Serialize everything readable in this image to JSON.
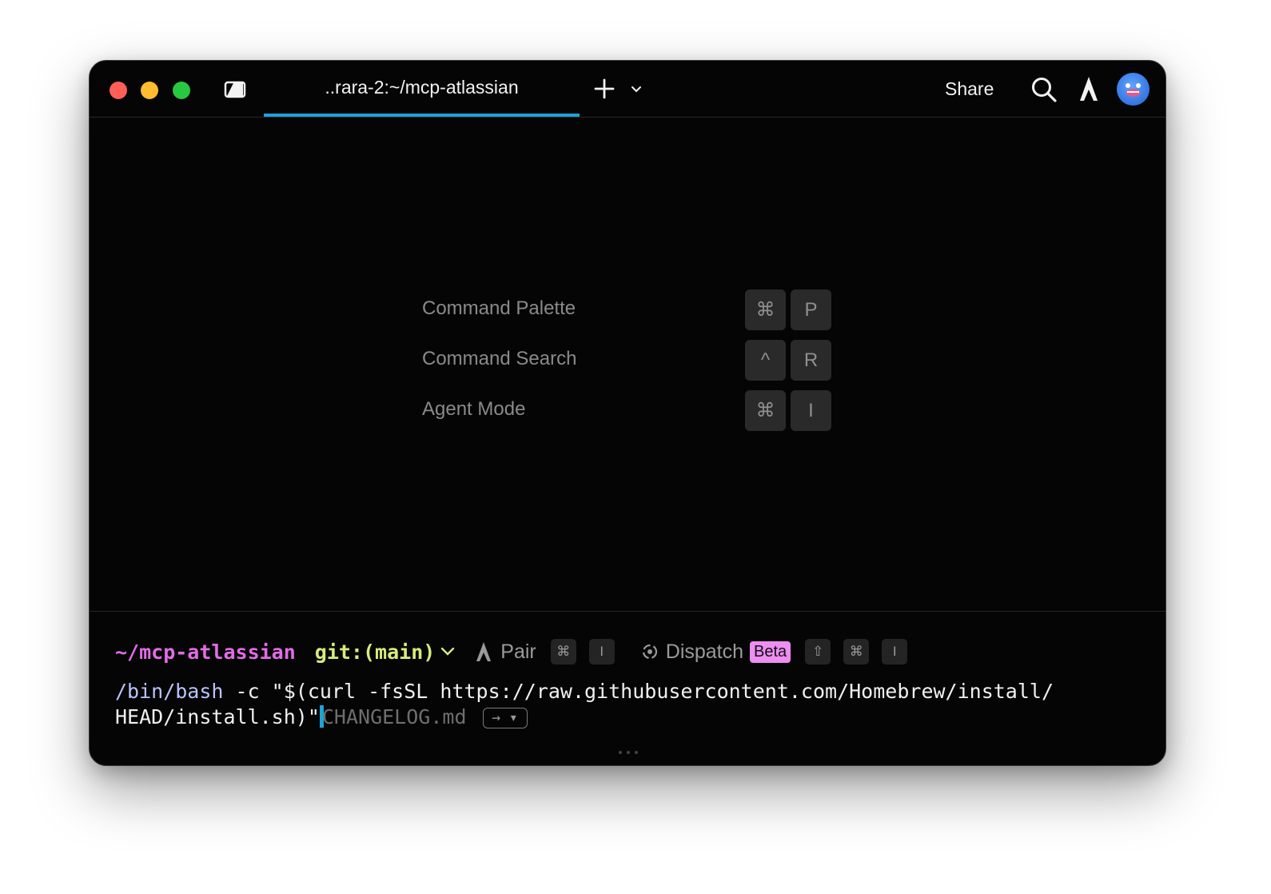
{
  "window": {
    "tab_title": "..rara-2:~/mcp-atlassian",
    "share_label": "Share",
    "accent_color": "#1ba4d8"
  },
  "icons": {
    "panel": "panel-toggle-icon",
    "new_tab": "plus-icon",
    "tab_menu": "chevron-down-icon",
    "search": "search-icon",
    "agent": "rocket-icon",
    "avatar": "avatar"
  },
  "shortcuts": [
    {
      "label": "Command Palette",
      "keys": [
        "⌘",
        "P"
      ]
    },
    {
      "label": "Command Search",
      "keys": [
        "^",
        "R"
      ]
    },
    {
      "label": "Agent Mode",
      "keys": [
        "⌘",
        "I"
      ]
    }
  ],
  "prompt": {
    "cwd": "~/mcp-atlassian",
    "git": "git:(main)",
    "pair_label": "Pair",
    "pair_keys": [
      "⌘",
      "I"
    ],
    "dispatch_label": "Dispatch",
    "dispatch_badge": "Beta",
    "dispatch_keys": [
      "⇧",
      "⌘",
      "I"
    ]
  },
  "input": {
    "bin": "/bin/bash",
    "line1_rest": " -c \"$(curl -fsSL https://raw.githubusercontent.com/Homebrew/install/",
    "line2": "HEAD/install.sh)\"",
    "suggestion": "CHANGELOG.md",
    "accept_hint": "→ ▾"
  },
  "colors": {
    "cwd": "#e26ce6",
    "git": "#d6ec7a",
    "beta_badge": "#ee8ef1",
    "bin": "#b9c3ff"
  }
}
